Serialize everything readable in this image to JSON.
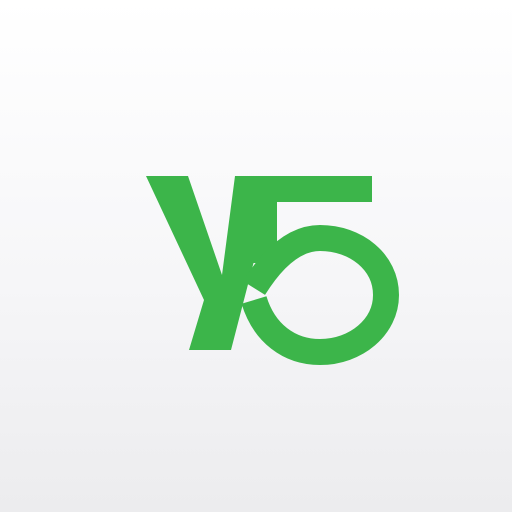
{
  "logo": {
    "text": "Y5",
    "icon": "y5-logo-icon",
    "color": "#3cb54a"
  },
  "background": {
    "top_color": "#ffffff",
    "bottom_color": "#ececee"
  }
}
